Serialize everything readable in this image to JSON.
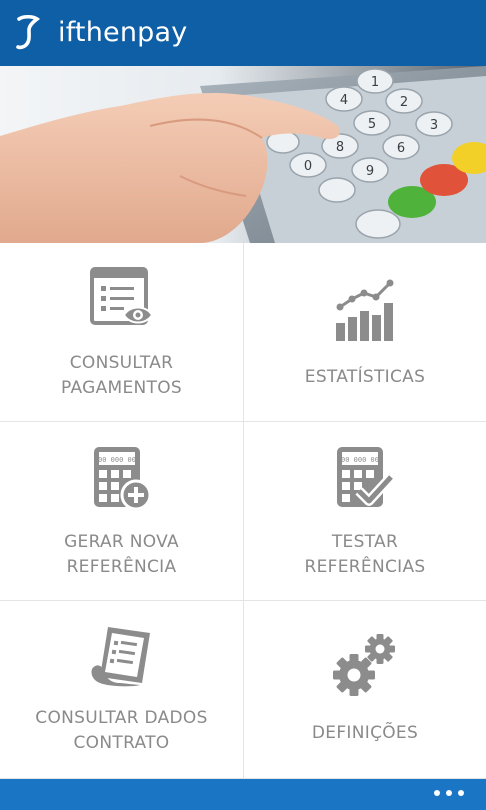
{
  "app": {
    "title": "ifthenpay",
    "logo_icon": "ifthenpay-logo-icon",
    "brand_color": "#0f5fa6",
    "appbar_color": "#1a76c4"
  },
  "hero": {
    "image_description_icon": "payment-terminal-keypad-photo"
  },
  "tiles": [
    {
      "icon": "payment-list-view-icon",
      "line1": "CONSULTAR",
      "line2": "PAGAMENTOS"
    },
    {
      "icon": "statistics-chart-icon",
      "line1": "ESTATÍSTICAS",
      "line2": ""
    },
    {
      "icon": "calculator-add-icon",
      "line1": "GERAR NOVA",
      "line2": "REFERÊNCIA"
    },
    {
      "icon": "calculator-check-icon",
      "line1": "TESTAR",
      "line2": "REFERÊNCIAS"
    },
    {
      "icon": "contract-document-icon",
      "line1": "CONSULTAR DADOS",
      "line2": "CONTRATO"
    },
    {
      "icon": "settings-gears-icon",
      "line1": "DEFINIÇÕES",
      "line2": ""
    }
  ],
  "appbar": {
    "more_icon": "more-options-icon"
  },
  "colors": {
    "tile_text": "#8a8a8a",
    "tile_icon": "#8c8c8c",
    "divider": "#e4e4e4"
  }
}
